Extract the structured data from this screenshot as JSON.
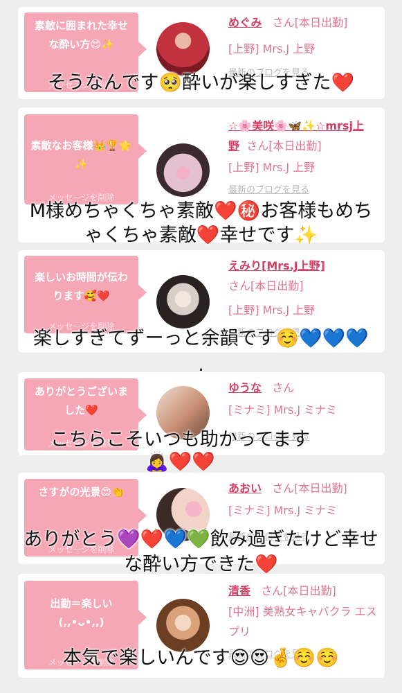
{
  "cards": [
    {
      "bubble": "素敵に囲まれた幸せな酔い方😍✨",
      "delete": "メッセージを削除",
      "name": "めぐみ",
      "suffix": "さん[本日出勤]",
      "shop": "[上野] Mrs.J 上野",
      "blog": "最新のブログを見る",
      "avatar_colors": [
        "#7a1a22",
        "#c2333f",
        "#e9b8a8"
      ]
    },
    {
      "bubble": "素敵なお客様👑🏆🌟✨",
      "delete": "メッセージを削除",
      "name": "☆🌸美咲🌸🦋✨☆mrsj上野",
      "suffix": "さん[本日出勤]",
      "shop": "[上野] Mrs.J 上野",
      "blog": "最新のブログを見る",
      "avatar_colors": [
        "#e3c1cf",
        "#c98aa6",
        "#3a2a30"
      ]
    },
    {
      "bubble": "楽しいお時間が伝わります🥰❤️",
      "delete": "メッセージを削除",
      "name": "えみり[Mrs.J上野]",
      "suffix": "さん[本日出勤]",
      "shop": "[上野] Mrs.J 上野",
      "blog": "最新のブログを見る",
      "avatar_colors": [
        "#2a2220",
        "#d7cfc7",
        "#8c6f5b"
      ]
    },
    {
      "bubble": "ありがとうございました❤️",
      "delete": "メッセージを削除",
      "name": "ゆうな",
      "suffix": "さん",
      "shop": "[ミナミ] Mrs.J ミナミ",
      "blog": "最新のブログを見る",
      "avatar_colors": [
        "#f0ddd2",
        "#c98f74",
        "#6e4b3d"
      ]
    },
    {
      "bubble": "さすがの光景😍👏",
      "delete": "メッセージを削除",
      "name": "あおい",
      "suffix": "さん[本日出勤]",
      "shop": "[ミナミ] Mrs.J ミナミ",
      "blog": "最新のブログを見る",
      "avatar_colors": [
        "#3b2a25",
        "#f1d3c8",
        "#f7b6c8"
      ]
    },
    {
      "bubble": "出勤＝楽しい (,,•ᴗ•,,)",
      "delete": "メッセージを削除",
      "name": "清香",
      "suffix": "さん[本日出勤]",
      "shop": "[中洲] 美熟女キャバクラ エスプリ",
      "blog": "最新のブログを見る",
      "avatar_colors": [
        "#6b3e22",
        "#d9a27a",
        "#f3d9c3"
      ]
    }
  ],
  "captions": [
    "そうなんです🥺酔いが楽しすぎた❤️",
    "M様めちゃくちゃ素敵❤️㊙️お客様もめち",
    "ゃくちゃ素敵❤️幸せです✨",
    "楽しすぎてずーっと余韻です☺️💙💙💙",
    ".",
    "こちらこそいつも助かってます",
    "🙇‍♀️❤️❤️",
    "ありがとう💜❤️💙💚飲み過ぎたけど幸せ",
    "な酔い方できた❤️",
    "本気で楽しいんです😍😍🤞☺️☺️"
  ]
}
